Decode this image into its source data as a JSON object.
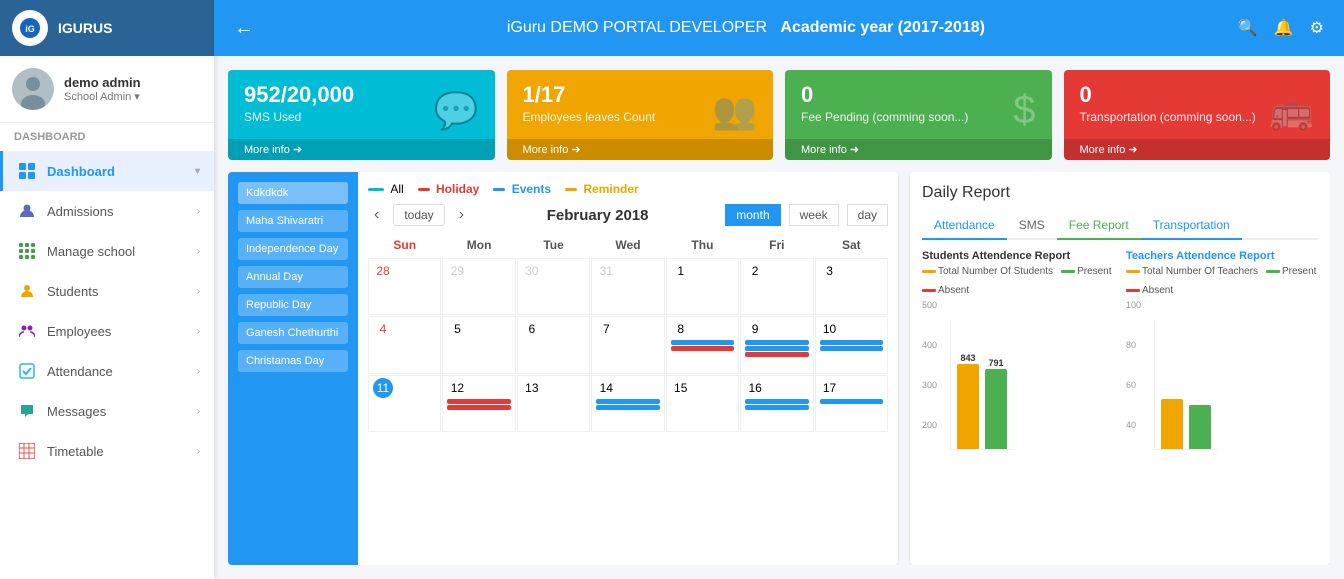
{
  "sidebar": {
    "logo_text": "IGURUS",
    "user_name": "demo admin",
    "user_role": "School Admin",
    "section_label": "Dashboard",
    "items": [
      {
        "id": "dashboard",
        "label": "Dashboard",
        "icon": "grid",
        "active": true,
        "has_sub": true
      },
      {
        "id": "admissions",
        "label": "Admissions",
        "icon": "drop",
        "active": false,
        "has_sub": true
      },
      {
        "id": "manage-school",
        "label": "Manage school",
        "icon": "grid-small",
        "active": false,
        "has_sub": true
      },
      {
        "id": "students",
        "label": "Students",
        "icon": "person",
        "active": false,
        "has_sub": true
      },
      {
        "id": "employees",
        "label": "Employees",
        "icon": "people",
        "active": false,
        "has_sub": true
      },
      {
        "id": "attendance",
        "label": "Attendance",
        "icon": "check",
        "active": false,
        "has_sub": true
      },
      {
        "id": "messages",
        "label": "Messages",
        "icon": "chat",
        "active": false,
        "has_sub": true
      },
      {
        "id": "timetable",
        "label": "Timetable",
        "icon": "table",
        "active": false,
        "has_sub": true
      }
    ]
  },
  "header": {
    "back_label": "←",
    "title": "iGuru DEMO PORTAL DEVELOPER",
    "year": "Academic year (2017-2018)"
  },
  "stat_cards": [
    {
      "id": "sms",
      "number": "952/20,000",
      "label": "SMS Used",
      "footer": "More info ➜",
      "color": "blue",
      "icon": "💬"
    },
    {
      "id": "employees-leaves",
      "number": "1/17",
      "label": "Employees leaves Count",
      "footer": "More info ➜",
      "color": "orange",
      "icon": "👥"
    },
    {
      "id": "fee-pending",
      "number": "0",
      "label": "Fee Pending (comming soon...)",
      "footer": "More info ➜",
      "color": "green",
      "icon": "$"
    },
    {
      "id": "transportation",
      "number": "0",
      "label": "Transportation (comming soon...)",
      "footer": "More info ➜",
      "color": "red",
      "icon": "🚌"
    }
  ],
  "calendar": {
    "legend": [
      {
        "label": "All",
        "color": "#00bcd4"
      },
      {
        "label": "Holiday",
        "color": "#e53935"
      },
      {
        "label": "Events",
        "color": "#2196f3"
      },
      {
        "label": "Reminder",
        "color": "#f0a500"
      }
    ],
    "month_title": "February 2018",
    "nav_prev": "‹",
    "nav_next": "›",
    "today_btn": "today",
    "view_buttons": [
      "month",
      "week",
      "day"
    ],
    "active_view": "month",
    "day_names": [
      "Sun",
      "Mon",
      "Tue",
      "Wed",
      "Thu",
      "Fri",
      "Sat"
    ],
    "events_list": [
      {
        "label": "Kdkdkdk",
        "selected": true
      },
      {
        "label": "Maha Shivaratri",
        "selected": false
      },
      {
        "label": "Independence Day",
        "selected": false
      },
      {
        "label": "Annual Day",
        "selected": false
      },
      {
        "label": "Republic Day",
        "selected": false
      },
      {
        "label": "Ganesh Chethurthi",
        "selected": false
      },
      {
        "label": "Christamas Day",
        "selected": false
      }
    ],
    "cells": [
      {
        "num": "28",
        "other": true,
        "sunday": true,
        "events": []
      },
      {
        "num": "29",
        "other": true,
        "events": []
      },
      {
        "num": "30",
        "other": true,
        "events": []
      },
      {
        "num": "31",
        "other": true,
        "events": []
      },
      {
        "num": "1",
        "other": false,
        "events": []
      },
      {
        "num": "2",
        "other": false,
        "events": []
      },
      {
        "num": "3",
        "other": false,
        "events": []
      },
      {
        "num": "4",
        "other": false,
        "sunday": true,
        "events": []
      },
      {
        "num": "5",
        "other": false,
        "events": []
      },
      {
        "num": "6",
        "other": false,
        "events": []
      },
      {
        "num": "7",
        "other": false,
        "events": []
      },
      {
        "num": "8",
        "other": false,
        "events": [
          {
            "color": "blue"
          },
          {
            "color": "red"
          }
        ]
      },
      {
        "num": "9",
        "other": false,
        "events": [
          {
            "color": "blue"
          },
          {
            "color": "blue"
          },
          {
            "color": "red"
          }
        ]
      },
      {
        "num": "10",
        "other": false,
        "events": [
          {
            "color": "blue"
          },
          {
            "color": "blue"
          }
        ]
      },
      {
        "num": "11",
        "other": false,
        "sunday": true,
        "today": true,
        "events": []
      },
      {
        "num": "12",
        "other": false,
        "events": [
          {
            "color": "red"
          },
          {
            "color": "red"
          }
        ]
      },
      {
        "num": "13",
        "other": false,
        "events": []
      },
      {
        "num": "14",
        "other": false,
        "events": [
          {
            "color": "blue"
          },
          {
            "color": "blue"
          }
        ]
      },
      {
        "num": "15",
        "other": false,
        "events": []
      },
      {
        "num": "16",
        "other": false,
        "events": [
          {
            "color": "blue"
          },
          {
            "color": "blue"
          }
        ]
      },
      {
        "num": "17",
        "other": false,
        "events": [
          {
            "color": "blue"
          }
        ]
      }
    ]
  },
  "daily_report": {
    "title": "Daily Report",
    "tabs": [
      {
        "label": "Attendance",
        "active": true
      },
      {
        "label": "SMS",
        "active": false
      },
      {
        "label": "Fee Report",
        "active": false
      },
      {
        "label": "Transportation",
        "active": false
      }
    ],
    "students_chart": {
      "title": "Students Attendence Report",
      "legend": [
        {
          "label": "Total Number Of Students",
          "color": "#f0a500"
        },
        {
          "label": "Present",
          "color": "#4caf50"
        },
        {
          "label": "Absent",
          "color": "#e53935"
        }
      ],
      "values": {
        "total": 843,
        "present": 791
      },
      "y_axis": [
        "500",
        "400",
        "300",
        "200"
      ]
    },
    "teachers_chart": {
      "title": "Teachers Attendence Report",
      "title_color": "#2196f3",
      "legend": [
        {
          "label": "Total Number Of Teachers",
          "color": "#f0a500"
        },
        {
          "label": "Present",
          "color": "#4caf50"
        },
        {
          "label": "Absent",
          "color": "#e53935"
        }
      ],
      "y_axis": [
        "100",
        "80",
        "60",
        "40"
      ]
    }
  }
}
